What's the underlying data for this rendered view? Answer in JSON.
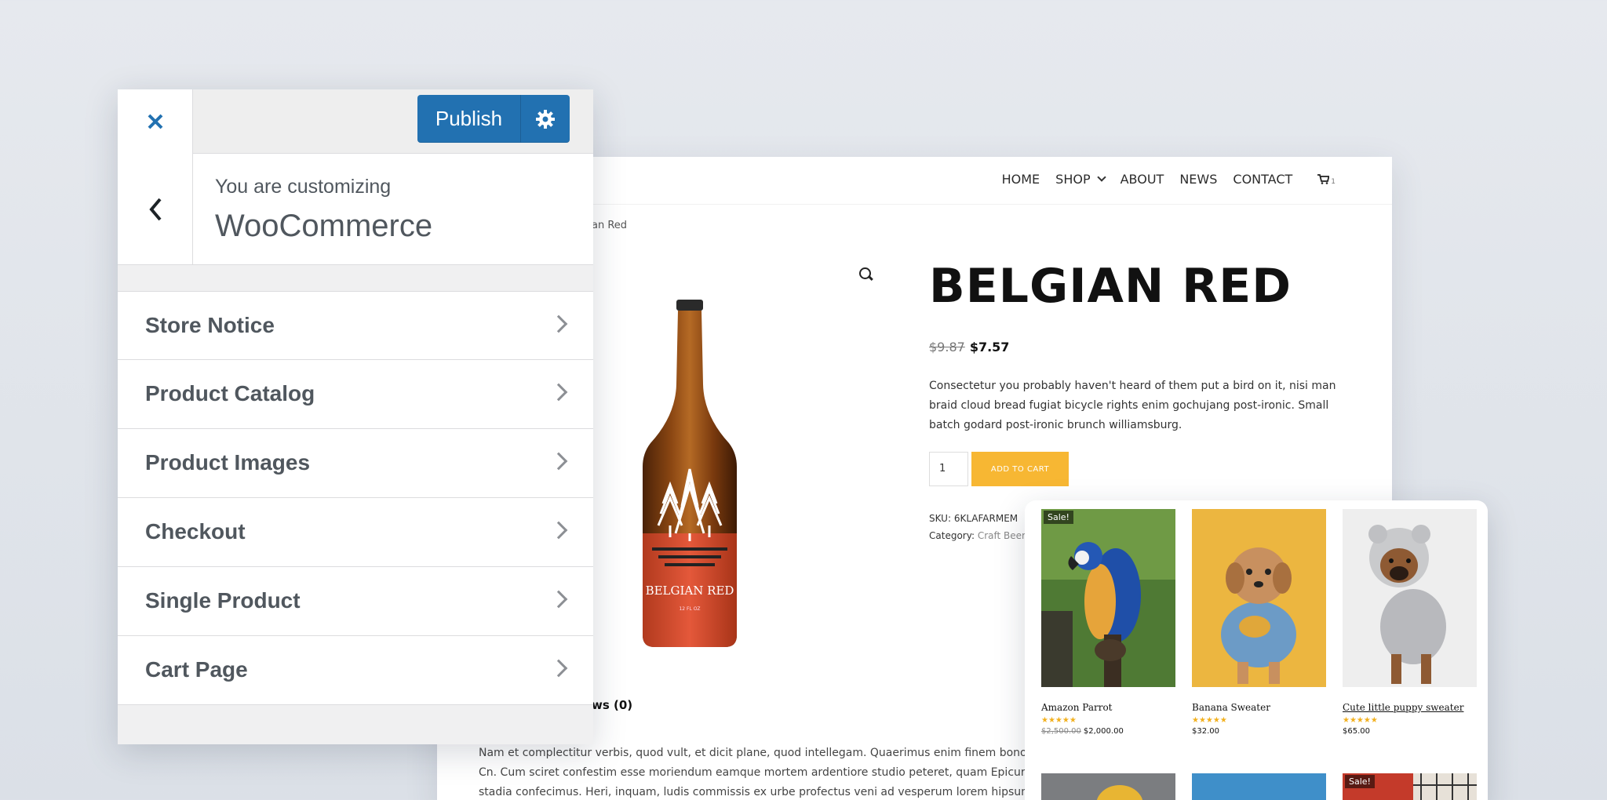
{
  "store": {
    "nav": [
      {
        "label": "HOME"
      },
      {
        "label": "SHOP",
        "has_dropdown": true
      },
      {
        "label": "ABOUT"
      },
      {
        "label": "NEWS"
      },
      {
        "label": "CONTACT"
      }
    ],
    "cart_count": "1",
    "breadcrumb_tail": "an Red",
    "product": {
      "title": "BELGIAN RED",
      "price_old": "$9.87",
      "price_new": "$7.57",
      "description": "Consectetur you probably haven't heard of them put a bird on it, nisi man braid cloud bread fugiat bicycle rights enim gochujang post-ironic. Small batch godard post-ironic brunch williamsburg.",
      "quantity": "1",
      "add_to_cart_label": "ADD TO CART",
      "sku_label": "SKU:",
      "sku": "6KLAFARMEM",
      "category_label": "Category:",
      "category": "Craft Beer",
      "bottle_label": "BELGIAN RED",
      "bottle_volume": "12 FL OZ"
    },
    "reviews_tab": "ws (0)",
    "review_lines": [
      "Nam et complectitur verbis, quod vult, et dicit plane, quod intellegam. Quaerimus enim finem bonorum. Illu",
      "Cn. Cum sciret confestim esse moriendum eamque mortem ardentiore studio peteret, quam Epicurus volupt",
      "stadia confecimus. Heri, inquam, ludis commissis ex urbe profectus veni ad vesperum lorem hipsum. Small b"
    ]
  },
  "customizer": {
    "publish_label": "Publish",
    "customizing_label": "You are customizing",
    "customizing_title": "WooCommerce",
    "sections": [
      {
        "label": "Store Notice"
      },
      {
        "label": "Product Catalog"
      },
      {
        "label": "Product Images"
      },
      {
        "label": "Checkout"
      },
      {
        "label": "Single Product"
      },
      {
        "label": "Cart Page"
      }
    ]
  },
  "grid": {
    "products": [
      {
        "name": "Amazon Parrot",
        "rating": 5,
        "price_old": "$2,500.00",
        "price": "$2,000.00",
        "sale_badge": "Sale!"
      },
      {
        "name": "Banana Sweater",
        "rating": 5,
        "price": "$32.00"
      },
      {
        "name": "Cute little puppy sweater",
        "rating": 5,
        "price": "$65.00"
      }
    ],
    "row2_sale_badge": "Sale!"
  },
  "colors": {
    "publish_blue": "#2271b1",
    "close_blue": "#2271b1",
    "add_to_cart": "#f7b733",
    "star": "#f2b01e",
    "panel_text": "#50575e"
  },
  "icons": {
    "close": "close-icon",
    "settings": "gear-icon",
    "back": "chevron-left-icon",
    "section_arrow": "chevron-right-icon",
    "zoom": "search-icon",
    "cart": "cart-icon"
  }
}
